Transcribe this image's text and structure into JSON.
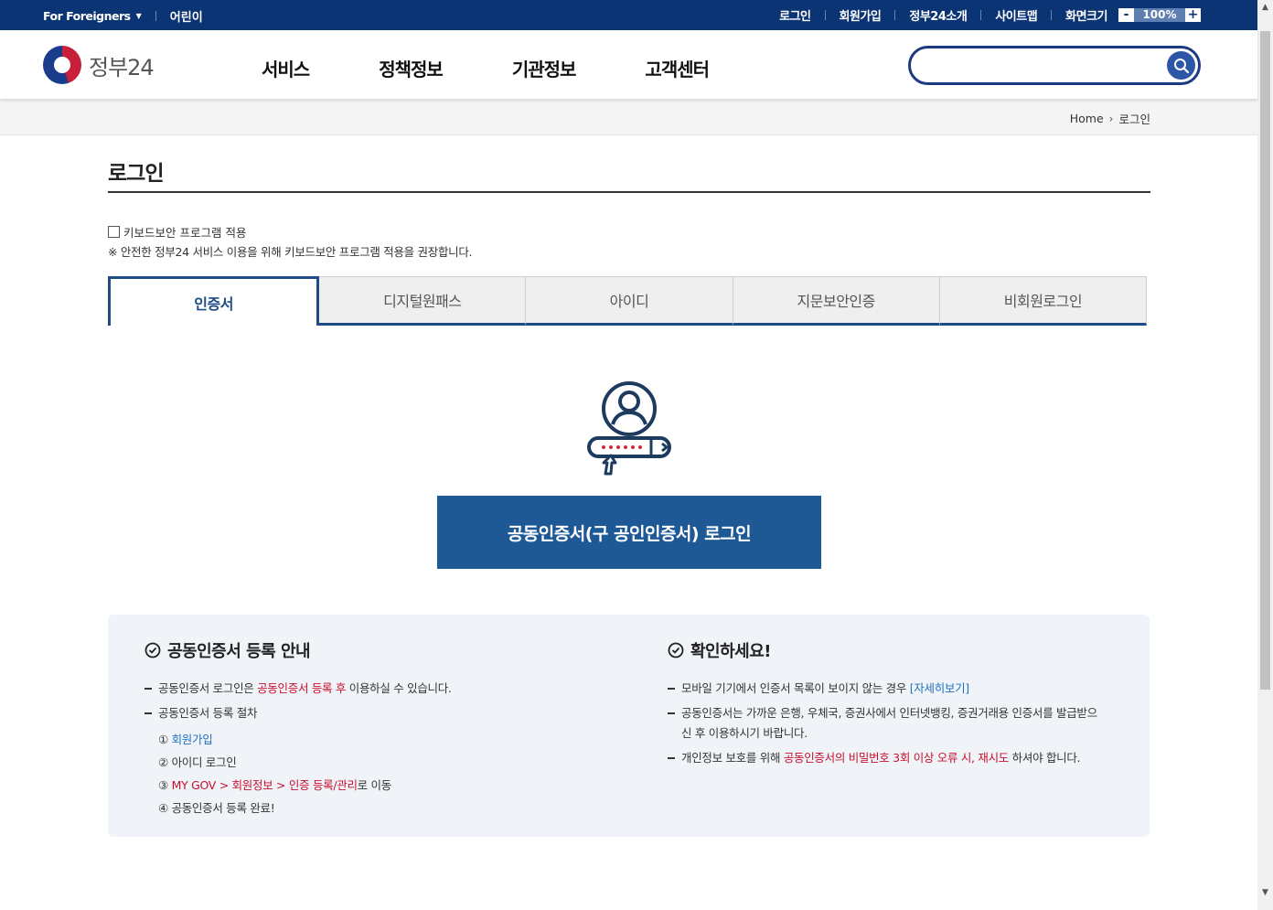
{
  "topbar": {
    "for_foreigners": "For Foreigners",
    "kids": "어린이",
    "links": [
      "로그인",
      "회원가입",
      "정부24소개",
      "사이트맵"
    ],
    "zoom_label": "화면크기",
    "zoom_minus": "-",
    "zoom_value": "100%",
    "zoom_plus": "+"
  },
  "header": {
    "logo_text": "정부24",
    "nav": [
      "서비스",
      "정책정보",
      "기관정보",
      "고객센터"
    ],
    "search_placeholder": ""
  },
  "breadcrumb": {
    "home": "Home",
    "current": "로그인"
  },
  "page": {
    "title": "로그인",
    "keyboard_security_label": "키보드보안 프로그램 적용",
    "keyboard_security_note": "※ 안전한 정부24 서비스 이용을 위해 키보드보안 프로그램 적용을 권장합니다."
  },
  "tabs": [
    "인증서",
    "디지털원패스",
    "아이디",
    "지문보안인증",
    "비회원로그인"
  ],
  "active_tab": "인증서",
  "login_button": "공동인증서(구 공인인증서) 로그인",
  "info_left": {
    "title": "공동인증서 등록 안내",
    "item1_pre": "공동인증서 로그인은 ",
    "item1_red": "공동인증서 등록 후",
    "item1_post": " 이용하실 수 있습니다.",
    "item2": "공동인증서 등록 절차",
    "step1_num": "①",
    "step1_link": "회원가입",
    "step2": "② 아이디 로그인",
    "step3_num": "③",
    "step3_red": "MY GOV > 회원정보 > 인증 등록/관리",
    "step3_post": "로 이동",
    "step4": "④ 공동인증서 등록 완료!"
  },
  "info_right": {
    "title": "확인하세요!",
    "item1_pre": "모바일 기기에서 인증서 목록이 보이지 않는 경우 ",
    "item1_link": "[자세히보기]",
    "item2": "공동인증서는 가까운 은행, 우체국, 증권사에서 인터넷뱅킹, 증권거래용 인증서를 발급받으신 후 이용하시기 바랍니다.",
    "item3_pre": "개인정보 보호를 위해 ",
    "item3_red": "공동인증서의 비밀번호 3회 이상 오류 시, 재시도",
    "item3_post": " 하셔야 합니다."
  },
  "colors": {
    "topbar": "#0b3474",
    "accent": "#1e4c86",
    "button": "#1e5996",
    "highlight_red": "#c8102e",
    "link_blue": "#1f6fc0"
  }
}
